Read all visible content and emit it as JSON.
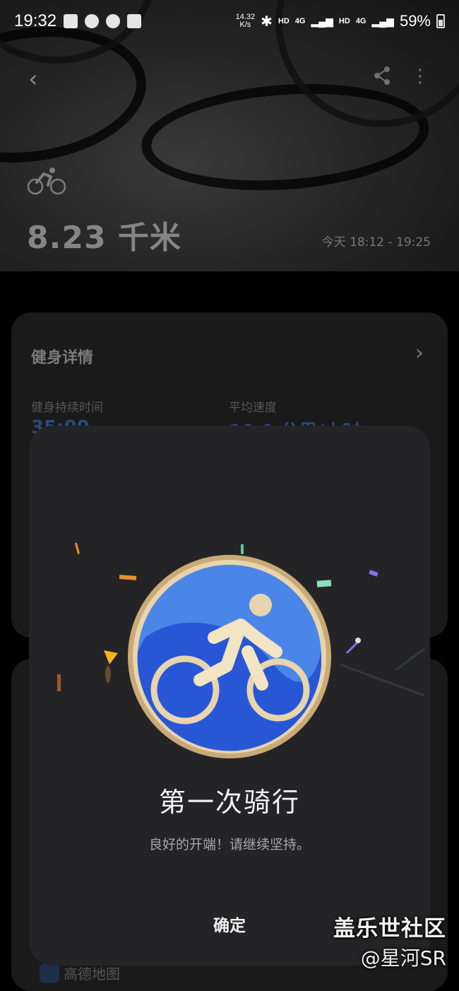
{
  "status_bar": {
    "time": "19:32",
    "net_speed_value": "14.32",
    "net_speed_unit": "K/s",
    "hd1": "HD",
    "net1": "4G",
    "hd2": "HD",
    "net2": "4G",
    "battery": "59%"
  },
  "workout": {
    "distance": "8.23 千米",
    "time_range": "今天 18:12 - 19:25"
  },
  "details_card": {
    "title": "健身详情",
    "duration_label": "健身持续时间",
    "duration_value": "35:00",
    "speed_label": "平均速度",
    "speed_value": "10.0 公里/小时"
  },
  "map_source": "高德地图",
  "dialog": {
    "title": "第一次骑行",
    "subtitle": "良好的开端！请继续坚持。",
    "confirm_label": "确定"
  },
  "watermark": {
    "line1": "盖乐世社区",
    "line2": "@星河SR"
  },
  "colors": {
    "badge_blue": "#4a86e8",
    "badge_deep_blue": "#2857d6",
    "badge_gold": "#e6cfa6",
    "dialog_bg": "#242426"
  },
  "icons": [
    "back-icon",
    "share-icon",
    "more-icon",
    "bicycle-icon",
    "chevron-right-icon",
    "cycling-badge-icon"
  ]
}
